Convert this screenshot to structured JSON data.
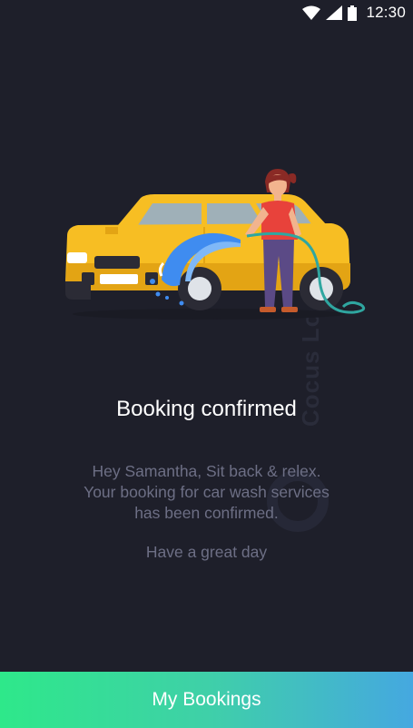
{
  "status_bar": {
    "time": "12:30",
    "icons": [
      "wifi-icon",
      "cellular-signal-icon",
      "battery-icon"
    ]
  },
  "illustration": {
    "name": "woman-washing-yellow-car",
    "colors": {
      "car": "#f7be23",
      "car_dark": "#e3a414",
      "shirt": "#e8423b",
      "pants": "#5b4a86",
      "water": "#3f8cf0",
      "hose": "#2fa6a0"
    }
  },
  "content": {
    "title": "Booking confirmed",
    "message_lines": [
      "Hey Samantha, Sit back & relex.",
      "Your booking for car wash services",
      "has been confirmed."
    ],
    "sub_message": "Have a great day"
  },
  "watermark": {
    "text": "Cocus Lo"
  },
  "bottom_button": {
    "label": "My Bookings",
    "gradient": [
      "#2ee88a",
      "#45a8e0"
    ]
  },
  "colors": {
    "background": "#1e1f2a",
    "title_text": "#ffffff",
    "body_text": "#6d6f85"
  }
}
